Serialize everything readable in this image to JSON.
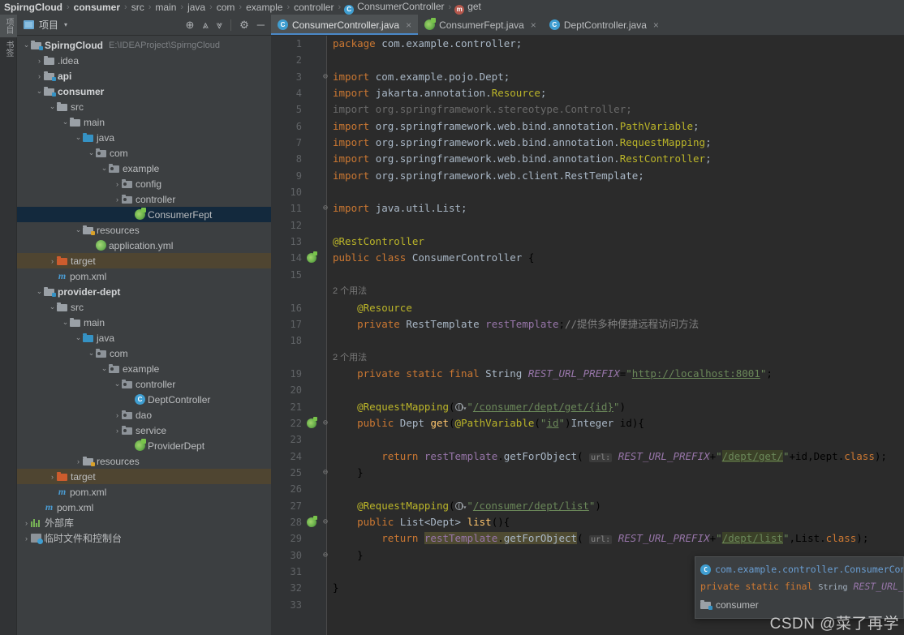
{
  "breadcrumb": [
    {
      "label": "SpirngCloud",
      "bold": true,
      "icon": ""
    },
    {
      "label": "consumer",
      "bold": true,
      "icon": ""
    },
    {
      "label": "src",
      "bold": false,
      "icon": ""
    },
    {
      "label": "main",
      "bold": false,
      "icon": ""
    },
    {
      "label": "java",
      "bold": false,
      "icon": ""
    },
    {
      "label": "com",
      "bold": false,
      "icon": ""
    },
    {
      "label": "example",
      "bold": false,
      "icon": ""
    },
    {
      "label": "controller",
      "bold": false,
      "icon": ""
    },
    {
      "label": "ConsumerController",
      "bold": false,
      "icon": "class-icon",
      "glyph": "C"
    },
    {
      "label": "get",
      "bold": false,
      "icon": "method-icon",
      "glyph": "m"
    }
  ],
  "vstrip": {
    "buttons": [
      {
        "label": "项目",
        "active": true,
        "name": "tool-window-project"
      },
      {
        "label": "书签",
        "active": false,
        "name": "tool-window-bookmarks"
      }
    ]
  },
  "project_panel": {
    "title": "项目",
    "caret": "▾",
    "tools": [
      {
        "name": "locate-icon",
        "glyph": "⊕"
      },
      {
        "name": "expand-all-icon",
        "glyph": "⩓"
      },
      {
        "name": "collapse-all-icon",
        "glyph": "⩔"
      },
      {
        "name": "settings-gear-icon",
        "glyph": "⚙"
      },
      {
        "name": "hide-panel-icon",
        "glyph": "─"
      }
    ]
  },
  "tree": [
    {
      "indent": 0,
      "arrow": "⌄",
      "icon": "module-folder",
      "label": "SpirngCloud",
      "bold": true,
      "path": "E:\\IDEAProject\\SpirngCloud",
      "state": "normal",
      "name": "tree-node-spirngcloud"
    },
    {
      "indent": 1,
      "arrow": "›",
      "icon": "folder",
      "label": ".idea",
      "bold": false,
      "state": "normal",
      "name": "tree-node-idea"
    },
    {
      "indent": 1,
      "arrow": "›",
      "icon": "module-folder",
      "label": "api",
      "bold": true,
      "state": "normal",
      "name": "tree-node-api"
    },
    {
      "indent": 1,
      "arrow": "⌄",
      "icon": "module-folder",
      "label": "consumer",
      "bold": true,
      "state": "normal",
      "name": "tree-node-consumer"
    },
    {
      "indent": 2,
      "arrow": "⌄",
      "icon": "folder",
      "label": "src",
      "bold": false,
      "state": "normal",
      "name": "tree-node-src"
    },
    {
      "indent": 3,
      "arrow": "⌄",
      "icon": "folder",
      "label": "main",
      "bold": false,
      "state": "normal",
      "name": "tree-node-main"
    },
    {
      "indent": 4,
      "arrow": "⌄",
      "icon": "source-folder",
      "label": "java",
      "bold": false,
      "state": "normal",
      "name": "tree-node-java"
    },
    {
      "indent": 5,
      "arrow": "⌄",
      "icon": "package",
      "label": "com",
      "bold": false,
      "state": "normal",
      "name": "tree-node-com"
    },
    {
      "indent": 6,
      "arrow": "⌄",
      "icon": "package",
      "label": "example",
      "bold": false,
      "state": "normal",
      "name": "tree-node-example"
    },
    {
      "indent": 7,
      "arrow": "›",
      "icon": "package",
      "label": "config",
      "bold": false,
      "state": "normal",
      "name": "tree-node-config"
    },
    {
      "indent": 7,
      "arrow": "›",
      "icon": "package",
      "label": "controller",
      "bold": false,
      "state": "normal",
      "name": "tree-node-controller"
    },
    {
      "indent": 8,
      "arrow": "",
      "icon": "spring-class",
      "label": "ConsumerFept",
      "bold": false,
      "state": "selected",
      "name": "tree-node-consumerfept"
    },
    {
      "indent": 4,
      "arrow": "⌄",
      "icon": "resource-folder",
      "label": "resources",
      "bold": false,
      "state": "normal",
      "name": "tree-node-resources-consumer"
    },
    {
      "indent": 5,
      "arrow": "",
      "icon": "yaml-file",
      "label": "application.yml",
      "bold": false,
      "state": "normal",
      "name": "tree-node-application-yml"
    },
    {
      "indent": 2,
      "arrow": "›",
      "icon": "target-folder",
      "label": "target",
      "bold": false,
      "state": "target",
      "name": "tree-node-target-consumer"
    },
    {
      "indent": 2,
      "arrow": "",
      "icon": "maven-file",
      "label": "pom.xml",
      "bold": false,
      "state": "normal",
      "name": "tree-node-pom-consumer"
    },
    {
      "indent": 1,
      "arrow": "⌄",
      "icon": "module-folder",
      "label": "provider-dept",
      "bold": true,
      "state": "normal",
      "name": "tree-node-provider-dept"
    },
    {
      "indent": 2,
      "arrow": "⌄",
      "icon": "folder",
      "label": "src",
      "bold": false,
      "state": "normal",
      "name": "tree-node-src-provider"
    },
    {
      "indent": 3,
      "arrow": "⌄",
      "icon": "folder",
      "label": "main",
      "bold": false,
      "state": "normal",
      "name": "tree-node-main-provider"
    },
    {
      "indent": 4,
      "arrow": "⌄",
      "icon": "source-folder",
      "label": "java",
      "bold": false,
      "state": "normal",
      "name": "tree-node-java-provider"
    },
    {
      "indent": 5,
      "arrow": "⌄",
      "icon": "package",
      "label": "com",
      "bold": false,
      "state": "normal",
      "name": "tree-node-com-provider"
    },
    {
      "indent": 6,
      "arrow": "⌄",
      "icon": "package",
      "label": "example",
      "bold": false,
      "state": "normal",
      "name": "tree-node-example-provider"
    },
    {
      "indent": 7,
      "arrow": "⌄",
      "icon": "package",
      "label": "controller",
      "bold": false,
      "state": "normal",
      "name": "tree-node-controller-provider"
    },
    {
      "indent": 8,
      "arrow": "",
      "icon": "class",
      "label": "DeptController",
      "bold": false,
      "state": "normal",
      "name": "tree-node-deptcontroller"
    },
    {
      "indent": 7,
      "arrow": "›",
      "icon": "package",
      "label": "dao",
      "bold": false,
      "state": "normal",
      "name": "tree-node-dao"
    },
    {
      "indent": 7,
      "arrow": "›",
      "icon": "package",
      "label": "service",
      "bold": false,
      "state": "normal",
      "name": "tree-node-service"
    },
    {
      "indent": 8,
      "arrow": "",
      "icon": "spring-class",
      "label": "ProviderDept",
      "bold": false,
      "state": "normal",
      "name": "tree-node-providerdept"
    },
    {
      "indent": 4,
      "arrow": "›",
      "icon": "resource-folder",
      "label": "resources",
      "bold": false,
      "state": "normal",
      "name": "tree-node-resources-provider"
    },
    {
      "indent": 2,
      "arrow": "›",
      "icon": "target-folder",
      "label": "target",
      "bold": false,
      "state": "target",
      "name": "tree-node-target-provider"
    },
    {
      "indent": 2,
      "arrow": "",
      "icon": "maven-file",
      "label": "pom.xml",
      "bold": false,
      "state": "normal",
      "name": "tree-node-pom-provider"
    },
    {
      "indent": 1,
      "arrow": "",
      "icon": "maven-file",
      "label": "pom.xml",
      "bold": false,
      "state": "normal",
      "name": "tree-node-pom-root"
    },
    {
      "indent": 0,
      "arrow": "›",
      "icon": "library",
      "label": "外部库",
      "bold": false,
      "state": "normal",
      "name": "tree-node-external-libraries"
    },
    {
      "indent": 0,
      "arrow": "›",
      "icon": "scratches",
      "label": "临时文件和控制台",
      "bold": false,
      "state": "normal",
      "name": "tree-node-scratches"
    }
  ],
  "tabs": [
    {
      "label": "ConsumerController.java",
      "icon": "class-icon",
      "active": true,
      "name": "tab-consumercontroller"
    },
    {
      "label": "ConsumerFept.java",
      "icon": "spring-class-icon",
      "active": false,
      "name": "tab-consumerfept"
    },
    {
      "label": "DeptController.java",
      "icon": "class-icon",
      "active": false,
      "name": "tab-deptcontroller"
    }
  ],
  "editor": {
    "close_glyph": "×",
    "lines": [
      {
        "n": 1,
        "fold": "",
        "run": false,
        "html": "<span class='kw'>package</span> <span class='id'>com.example.controller</span><span class='id'>;</span>"
      },
      {
        "n": 2,
        "fold": "",
        "run": false,
        "html": ""
      },
      {
        "n": 3,
        "fold": "⊖",
        "run": false,
        "html": "<span class='kw'>import</span> <span class='id'>com.example.pojo.Dept</span><span class='id'>;</span>"
      },
      {
        "n": 4,
        "fold": "",
        "run": false,
        "html": "<span class='kw'>import</span> <span class='id'>jakarta.annotation.</span><span class='anno'>Resource</span><span class='id'>;</span>"
      },
      {
        "n": 5,
        "fold": "",
        "run": false,
        "html": "<span class='dim'>import org.springframework.stereotype.Controller;</span>"
      },
      {
        "n": 6,
        "fold": "",
        "run": false,
        "html": "<span class='kw'>import</span> <span class='id'>org.springframework.web.bind.annotation.</span><span class='anno'>PathVariable</span><span class='id'>;</span>"
      },
      {
        "n": 7,
        "fold": "",
        "run": false,
        "html": "<span class='kw'>import</span> <span class='id'>org.springframework.web.bind.annotation.</span><span class='anno'>RequestMapping</span><span class='id'>;</span>"
      },
      {
        "n": 8,
        "fold": "",
        "run": false,
        "html": "<span class='kw'>import</span> <span class='id'>org.springframework.web.bind.annotation.</span><span class='anno'>RestController</span><span class='id'>;</span>"
      },
      {
        "n": 9,
        "fold": "",
        "run": false,
        "html": "<span class='kw'>import</span> <span class='id'>org.springframework.web.client.RestTemplate</span><span class='id'>;</span>"
      },
      {
        "n": 10,
        "fold": "",
        "run": false,
        "html": ""
      },
      {
        "n": 11,
        "fold": "⊖",
        "run": false,
        "html": "<span class='kw'>import</span> <span class='id'>java.util.List</span><span class='id'>;</span>"
      },
      {
        "n": 12,
        "fold": "",
        "run": false,
        "html": ""
      },
      {
        "n": 13,
        "fold": "",
        "run": false,
        "html": "<span class='anno'>@RestController</span>"
      },
      {
        "n": 14,
        "fold": "",
        "run": true,
        "html": "<span class='kw'>public class</span> <span class='type'>ConsumerController</span> {"
      },
      {
        "n": 15,
        "fold": "",
        "run": false,
        "html": ""
      },
      {
        "n": "",
        "fold": "",
        "run": false,
        "hint": "2 个用法"
      },
      {
        "n": 16,
        "fold": "",
        "run": false,
        "html": "    <span class='anno'>@Resource</span>"
      },
      {
        "n": 17,
        "fold": "",
        "run": false,
        "html": "    <span class='kw'>private</span> <span class='type'>RestTemplate</span> <span class='fld'>restTemplate</span>;<span class='cmt'>//提供多种便捷远程访问方法</span>"
      },
      {
        "n": 18,
        "fold": "",
        "run": false,
        "html": ""
      },
      {
        "n": "",
        "fold": "",
        "run": false,
        "hint": "2 个用法"
      },
      {
        "n": 19,
        "fold": "",
        "run": false,
        "html": "    <span class='kw'>private static final</span> <span class='type'>String</span> <span class='cnst'>REST_URL_PREFIX</span>=<span class='str'>\"</span><span class='urlstr'>http://localhost:8001</span><span class='str'>\"</span>;"
      },
      {
        "n": 20,
        "fold": "",
        "run": false,
        "html": ""
      },
      {
        "n": 21,
        "fold": "",
        "run": false,
        "html": "    <span class='anno'>@RequestMapping</span>(<span class='globe-slot'></span><span class='str'>\"</span><span class='link'>/consumer/dept/get/{id}</span><span class='str'>\"</span>)"
      },
      {
        "n": 22,
        "fold": "⊖",
        "run": true,
        "html": "    <span class='kw'>public</span> <span class='type'>Dept</span> <span class='met'>get</span>(<span class='anno'>@PathVariable</span>(<span class='str'>\"</span><span class='link'>id</span><span class='str'>\"</span>)<span class='type'>Integer</span> id){"
      },
      {
        "n": 23,
        "fold": "",
        "run": false,
        "html": ""
      },
      {
        "n": 24,
        "fold": "",
        "run": false,
        "html": "        <span class='kw'>return</span> <span class='fld'>restTemplate</span>.<span class='id'>getForObject</span>( <span class='pname'>url:</span> <span class='cnst'>REST_URL_PREFIX</span>+<span class='str'>\"</span><span class='hl link'>/dept/get/</span><span class='str'>\"</span>+id,Dept.<span class='kw'>class</span>);"
      },
      {
        "n": 25,
        "fold": "⊖",
        "run": false,
        "html": "    }"
      },
      {
        "n": 26,
        "fold": "",
        "run": false,
        "html": ""
      },
      {
        "n": 27,
        "fold": "",
        "run": false,
        "html": "    <span class='anno'>@RequestMapping</span>(<span class='globe-slot'></span><span class='str'>\"</span><span class='link'>/consumer/dept/list</span><span class='str'>\"</span>)"
      },
      {
        "n": 28,
        "fold": "⊖",
        "run": true,
        "html": "    <span class='kw'>public</span> <span class='type'>List&lt;Dept&gt;</span> <span class='met'>list</span>(){"
      },
      {
        "n": 29,
        "fold": "",
        "run": false,
        "html": "        <span class='kw'>return</span> <span class='hlb'><span class='fld'>restTemplate</span>.<span class='id'>getForObject</span></span>( <span class='pname'>url:</span> <span class='cnst'>REST_URL_PREFIX</span>+<span class='str'>\"</span><span class='hl link'>/dept/list</span><span class='str'>\"</span>,List.<span class='kw'>class</span>);"
      },
      {
        "n": 30,
        "fold": "⊖",
        "run": false,
        "html": "    }"
      },
      {
        "n": 31,
        "fold": "",
        "run": false,
        "html": ""
      },
      {
        "n": 32,
        "fold": "",
        "run": false,
        "html": "}"
      },
      {
        "n": 33,
        "fold": "",
        "run": false,
        "html": ""
      }
    ]
  },
  "popup": {
    "class_icon_glyph": "C",
    "class_path": "com.example.controller.ConsumerContr",
    "signature_html": "<span class='kw'>private static final</span> <span class='psig' style='font-size:10px'>String</span> <span class='cnst'>REST_URL_P</span>",
    "module_label": "consumer"
  },
  "watermark": "CSDN @菜了再学",
  "colors": {
    "panel_bg": "#3c3f41",
    "editor_bg": "#2b2b2b",
    "gutter_bg": "#313335",
    "selection": "#13293d",
    "target_row": "#4f4531",
    "tab_active_underline": "#4a88c7",
    "accent_blue": "#3592c4"
  }
}
